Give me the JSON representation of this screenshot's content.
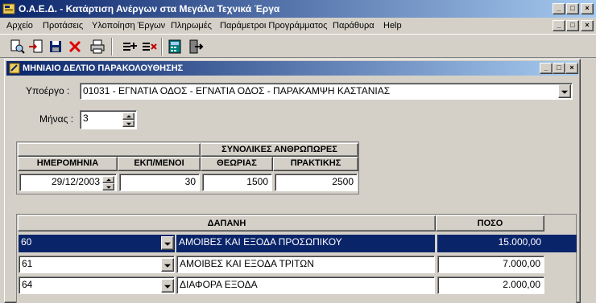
{
  "app": {
    "title": "Ο.Α.Ε.Δ. - Κατάρτιση Ανέργων στα Μεγάλα Τεχνικά Έργα"
  },
  "menu": [
    "Αρχείο",
    "Προτάσεις",
    "Υλοποίηση Έργων",
    "Πληρωμές",
    "Παράμετροι Προγράμματος",
    "Παράθυρα",
    "Help"
  ],
  "toolbar": {
    "icons": [
      "preview-icon",
      "import-icon",
      "save-icon",
      "delete-icon",
      "print-icon",
      "add-record-icon",
      "remove-record-icon",
      "calculator-icon",
      "exit-icon"
    ]
  },
  "child": {
    "title": "ΜΗΝΙΑΙΟ ΔΕΛΤΙΟ ΠΑΡΑΚΟΛΟΥΘΗΣΗΣ",
    "subproject_label": "Υποέργο :",
    "subproject_value": "01031 - ΕΓΝΑΤΙΑ ΟΔΟΣ - ΕΓΝΑΤΙΑ ΟΔΟΣ - ΠΑΡΑΚΑΜΨΗ ΚΑΣΤΑΝΙΑΣ",
    "month_label": "Μήνας :",
    "month_value": "3"
  },
  "hours_table": {
    "group_header": "ΣΥΝΟΛΙΚΕΣ ΑΝΘΡΩΠΩΡΕΣ",
    "headers": [
      "ΗΜΕΡΟΜΗΝΙΑ",
      "ΕΚΠ/ΜΕΝΟΙ",
      "ΘΕΩΡΙΑΣ",
      "ΠΡΑΚΤΙΚΗΣ"
    ],
    "row": [
      "29/12/2003",
      "30",
      "1500",
      "2500"
    ]
  },
  "expense_table": {
    "headers": [
      "ΔΑΠΑΝΗ",
      "ΠΟΣΟ"
    ],
    "rows": [
      {
        "code": "60",
        "description": "ΑΜΟΙΒΕΣ ΚΑΙ ΕΞΟΔΑ ΠΡΟΣΩΠΙΚΟΥ",
        "amount": "15.000,00"
      },
      {
        "code": "61",
        "description": "ΑΜΟΙΒΕΣ ΚΑΙ ΕΞΟΔΑ ΤΡΙΤΩΝ",
        "amount": "7.000,00"
      },
      {
        "code": "64",
        "description": "ΔΙΑΦΟΡΑ ΕΞΟΔΑ",
        "amount": "2.000,00"
      }
    ]
  },
  "colors": {
    "title_bar": "#0a246a",
    "face": "#d4d0c8",
    "selected_row": "#0a246a"
  }
}
